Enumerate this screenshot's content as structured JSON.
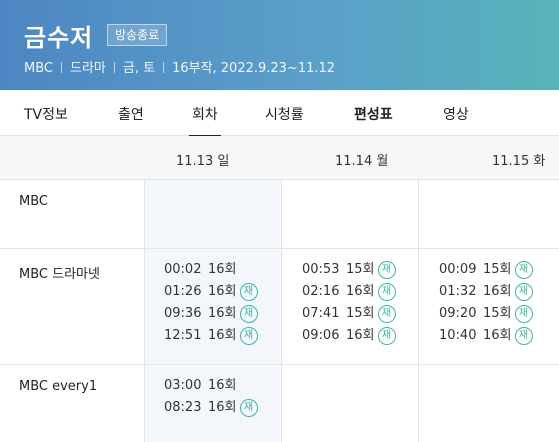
{
  "program": {
    "title": "금수저",
    "status_badge": "방송종료",
    "meta": [
      "MBC",
      "드라마",
      "금, 토",
      "16부작, 2022.9.23~11.12"
    ]
  },
  "tabs": [
    {
      "label": "TV정보"
    },
    {
      "label": "출연"
    },
    {
      "label": "회차"
    },
    {
      "label": "시청률"
    },
    {
      "label": "편성표"
    },
    {
      "label": "영상"
    }
  ],
  "active_tab": "회차",
  "days": [
    "11.13 일",
    "11.14 월",
    "11.15 화"
  ],
  "rerun_label": "재",
  "colors": {
    "header_from": "#4d86c2",
    "header_to": "#57b3b9",
    "rerun": "#3fb7a3"
  },
  "channels": [
    {
      "name": "MBC",
      "days": [
        [],
        [],
        []
      ]
    },
    {
      "name": "MBC 드라마넷",
      "days": [
        [
          {
            "time": "00:02",
            "ep": "16회",
            "rerun": false
          },
          {
            "time": "01:26",
            "ep": "16회",
            "rerun": true
          },
          {
            "time": "09:36",
            "ep": "16회",
            "rerun": true
          },
          {
            "time": "12:51",
            "ep": "16회",
            "rerun": true
          }
        ],
        [
          {
            "time": "00:53",
            "ep": "15회",
            "rerun": true
          },
          {
            "time": "02:16",
            "ep": "16회",
            "rerun": true
          },
          {
            "time": "07:41",
            "ep": "15회",
            "rerun": true
          },
          {
            "time": "09:06",
            "ep": "16회",
            "rerun": true
          }
        ],
        [
          {
            "time": "00:09",
            "ep": "15회",
            "rerun": true
          },
          {
            "time": "01:32",
            "ep": "16회",
            "rerun": true
          },
          {
            "time": "09:20",
            "ep": "15회",
            "rerun": true
          },
          {
            "time": "10:40",
            "ep": "16회",
            "rerun": true
          }
        ]
      ]
    },
    {
      "name": "MBC every1",
      "days": [
        [
          {
            "time": "03:00",
            "ep": "16회",
            "rerun": false
          },
          {
            "time": "08:23",
            "ep": "16회",
            "rerun": true
          }
        ],
        [],
        []
      ]
    }
  ]
}
